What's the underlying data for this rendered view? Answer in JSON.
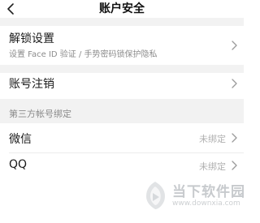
{
  "header": {
    "title": "账户安全",
    "back_icon": "chevron-left-icon"
  },
  "unlock": {
    "label": "解锁设置",
    "sub": "设置 Face ID 验证 / 手势密码锁保护隐私"
  },
  "deactivate": {
    "label": "账号注销"
  },
  "third_party": {
    "section_label": "第三方帐号绑定",
    "items": [
      {
        "label": "微信",
        "status": "未绑定"
      },
      {
        "label": "QQ",
        "status": "未绑定"
      }
    ]
  },
  "watermark": {
    "name": "当下软件园",
    "url": "www.downxia.com"
  },
  "colors": {
    "background": "#ffffff",
    "section_bg": "#f2f2f2",
    "secondary_text": "#8c8c8c",
    "status_text": "#b0b0b0"
  }
}
